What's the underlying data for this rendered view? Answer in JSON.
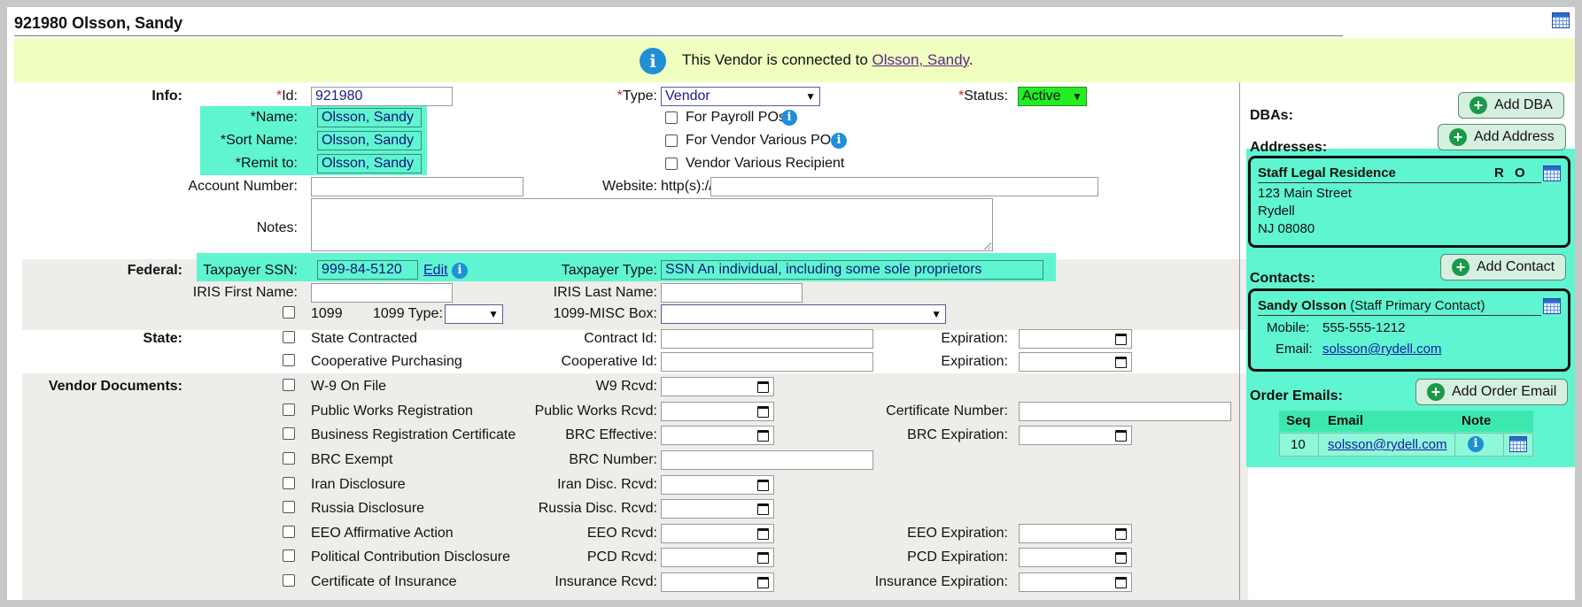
{
  "header": {
    "title": "921980 Olsson, Sandy",
    "banner_prefix": "This Vendor is connected to ",
    "banner_link": "Olsson, Sandy",
    "banner_suffix": "."
  },
  "info": {
    "section_label": "Info:",
    "id_label": "Id:",
    "id_value": "921980",
    "name_label": "*Name:",
    "name_value": "Olsson, Sandy",
    "sort_name_label": "*Sort Name:",
    "sort_name_value": "Olsson, Sandy",
    "remit_to_label": "*Remit to:",
    "remit_to_value": "Olsson, Sandy",
    "account_number_label": "Account Number:",
    "account_number_value": "",
    "notes_label": "Notes:",
    "type_label": "Type:",
    "type_value": "Vendor",
    "status_label": "Status:",
    "status_value": "Active",
    "for_payroll_label": "For Payroll POs",
    "for_vendor_various_label": "For Vendor Various POs",
    "vendor_various_recipient_label": "Vendor Various Recipient",
    "website_label": "Website:",
    "website_prefix": "http(s)://",
    "website_value": ""
  },
  "federal": {
    "section_label": "Federal:",
    "taxpayer_ssn_label": "Taxpayer SSN:",
    "taxpayer_ssn_value": "999-84-5120",
    "edit_link": "Edit",
    "taxpayer_type_label": "Taxpayer Type:",
    "taxpayer_type_value": "SSN An individual, including some sole proprietors",
    "iris_first_label": "IRIS First Name:",
    "iris_last_label": "IRIS Last Name:",
    "label_1099": "1099",
    "type_1099_label": "1099 Type:",
    "misc_box_label": "1099-MISC Box:"
  },
  "state": {
    "section_label": "State:",
    "state_contracted": "State Contracted",
    "contract_id_label": "Contract Id:",
    "expiration_label": "Expiration:",
    "cooperative_purchasing": "Cooperative Purchasing",
    "cooperative_id_label": "Cooperative Id:"
  },
  "documents": {
    "section_label": "Vendor Documents:",
    "rows": [
      {
        "check": "W-9 On File",
        "date_label": "W9 Rcvd:",
        "right_label": "",
        "right_kind": "none"
      },
      {
        "check": "Public Works Registration",
        "date_label": "Public Works Rcvd:",
        "right_label": "Certificate Number:",
        "right_kind": "text"
      },
      {
        "check": "Business Registration Certificate",
        "date_label": "BRC Effective:",
        "right_label": "BRC Expiration:",
        "right_kind": "date"
      },
      {
        "check": "BRC Exempt",
        "date_label": "BRC Number:",
        "right_label": "",
        "right_kind": "none",
        "mid_kind": "text"
      },
      {
        "check": "Iran Disclosure",
        "date_label": "Iran Disc. Rcvd:",
        "right_label": "",
        "right_kind": "none"
      },
      {
        "check": "Russia Disclosure",
        "date_label": "Russia Disc. Rcvd:",
        "right_label": "",
        "right_kind": "none"
      },
      {
        "check": "EEO Affirmative Action",
        "date_label": "EEO Rcvd:",
        "right_label": "EEO Expiration:",
        "right_kind": "date"
      },
      {
        "check": "Political Contribution Disclosure",
        "date_label": "PCD Rcvd:",
        "right_label": "PCD Expiration:",
        "right_kind": "date"
      },
      {
        "check": "Certificate of Insurance",
        "date_label": "Insurance Rcvd:",
        "right_label": "Insurance Expiration:",
        "right_kind": "date"
      }
    ]
  },
  "sidebar": {
    "dbas_label": "DBAs:",
    "add_dba": "Add DBA",
    "addresses_label": "Addresses:",
    "add_address": "Add Address",
    "address": {
      "title": "Staff Legal Residence",
      "flag_r": "R",
      "flag_o": "O",
      "line1": "123 Main Street",
      "line2": "Rydell",
      "line3": "NJ 08080"
    },
    "contacts_label": "Contacts:",
    "add_contact": "Add Contact",
    "contact": {
      "name": "Sandy Olsson",
      "role": "(Staff Primary Contact)",
      "mobile_label": "Mobile:",
      "mobile_value": "555-555-1212",
      "email_label": "Email:",
      "email_value": "solsson@rydell.com"
    },
    "order_emails_label": "Order Emails:",
    "add_order_email": "Add Order Email",
    "order_table": {
      "headers": [
        "Seq",
        "Email",
        "Note"
      ],
      "rows": [
        {
          "seq": "10",
          "email": "solsson@rydell.com"
        }
      ]
    }
  }
}
